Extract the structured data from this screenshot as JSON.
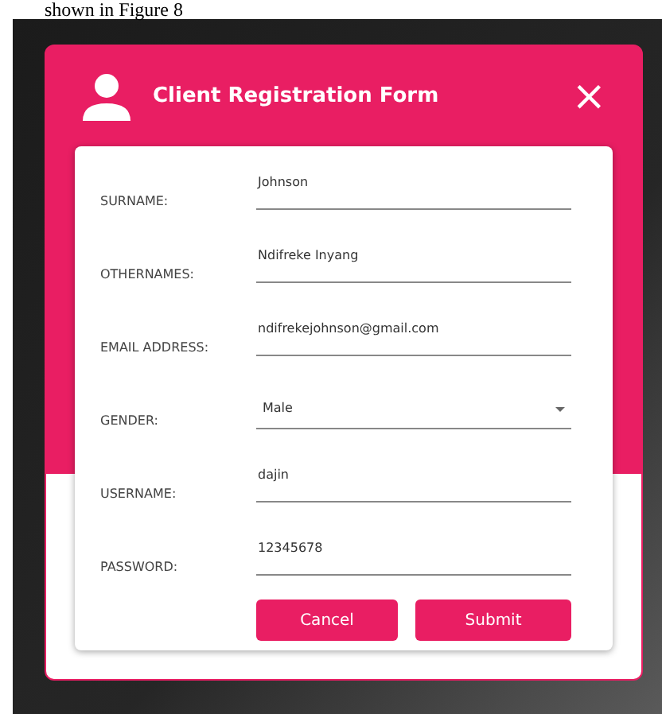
{
  "caption": "shown in Figure 8",
  "dialog": {
    "title": "Client Registration Form",
    "close": "×"
  },
  "fields": [
    {
      "kind": "text",
      "label": "SURNAME:",
      "value": "Johnson"
    },
    {
      "kind": "text",
      "label": "OTHERNAMES:",
      "value": "Ndifreke Inyang"
    },
    {
      "kind": "text",
      "label": "EMAIL ADDRESS:",
      "value": "ndifrekejohnson@gmail.com"
    },
    {
      "kind": "dropdown",
      "label": "GENDER:",
      "value": "Male"
    },
    {
      "kind": "text",
      "label": "USERNAME:",
      "value": "dajin"
    },
    {
      "kind": "text",
      "label": "PASSWORD:",
      "value": "12345678"
    }
  ],
  "buttons": [
    "Cancel",
    "Submit"
  ]
}
